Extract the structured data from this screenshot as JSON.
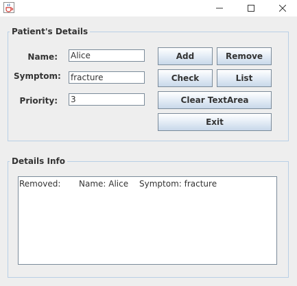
{
  "window": {
    "controls": {
      "minimize_icon": "minimize-icon",
      "maximize_icon": "maximize-icon",
      "close_icon": "close-icon"
    }
  },
  "patient_details": {
    "legend": "Patient's Details",
    "name_label": "Name:",
    "name_value": "Alice",
    "symptom_label": "Symptom:",
    "symptom_value": "fracture",
    "priority_label": "Priority:",
    "priority_value": "3"
  },
  "buttons": {
    "add": "Add",
    "remove": "Remove",
    "check": "Check",
    "list": "List",
    "clear": "Clear TextArea",
    "exit": "Exit"
  },
  "details_info": {
    "legend": "Details Info",
    "line": {
      "status": "Removed:",
      "name": "Name: Alice",
      "symptom": "Symptom: fracture"
    }
  },
  "colors": {
    "border_accent": "#b8cfe5",
    "background": "#eeeeee"
  }
}
